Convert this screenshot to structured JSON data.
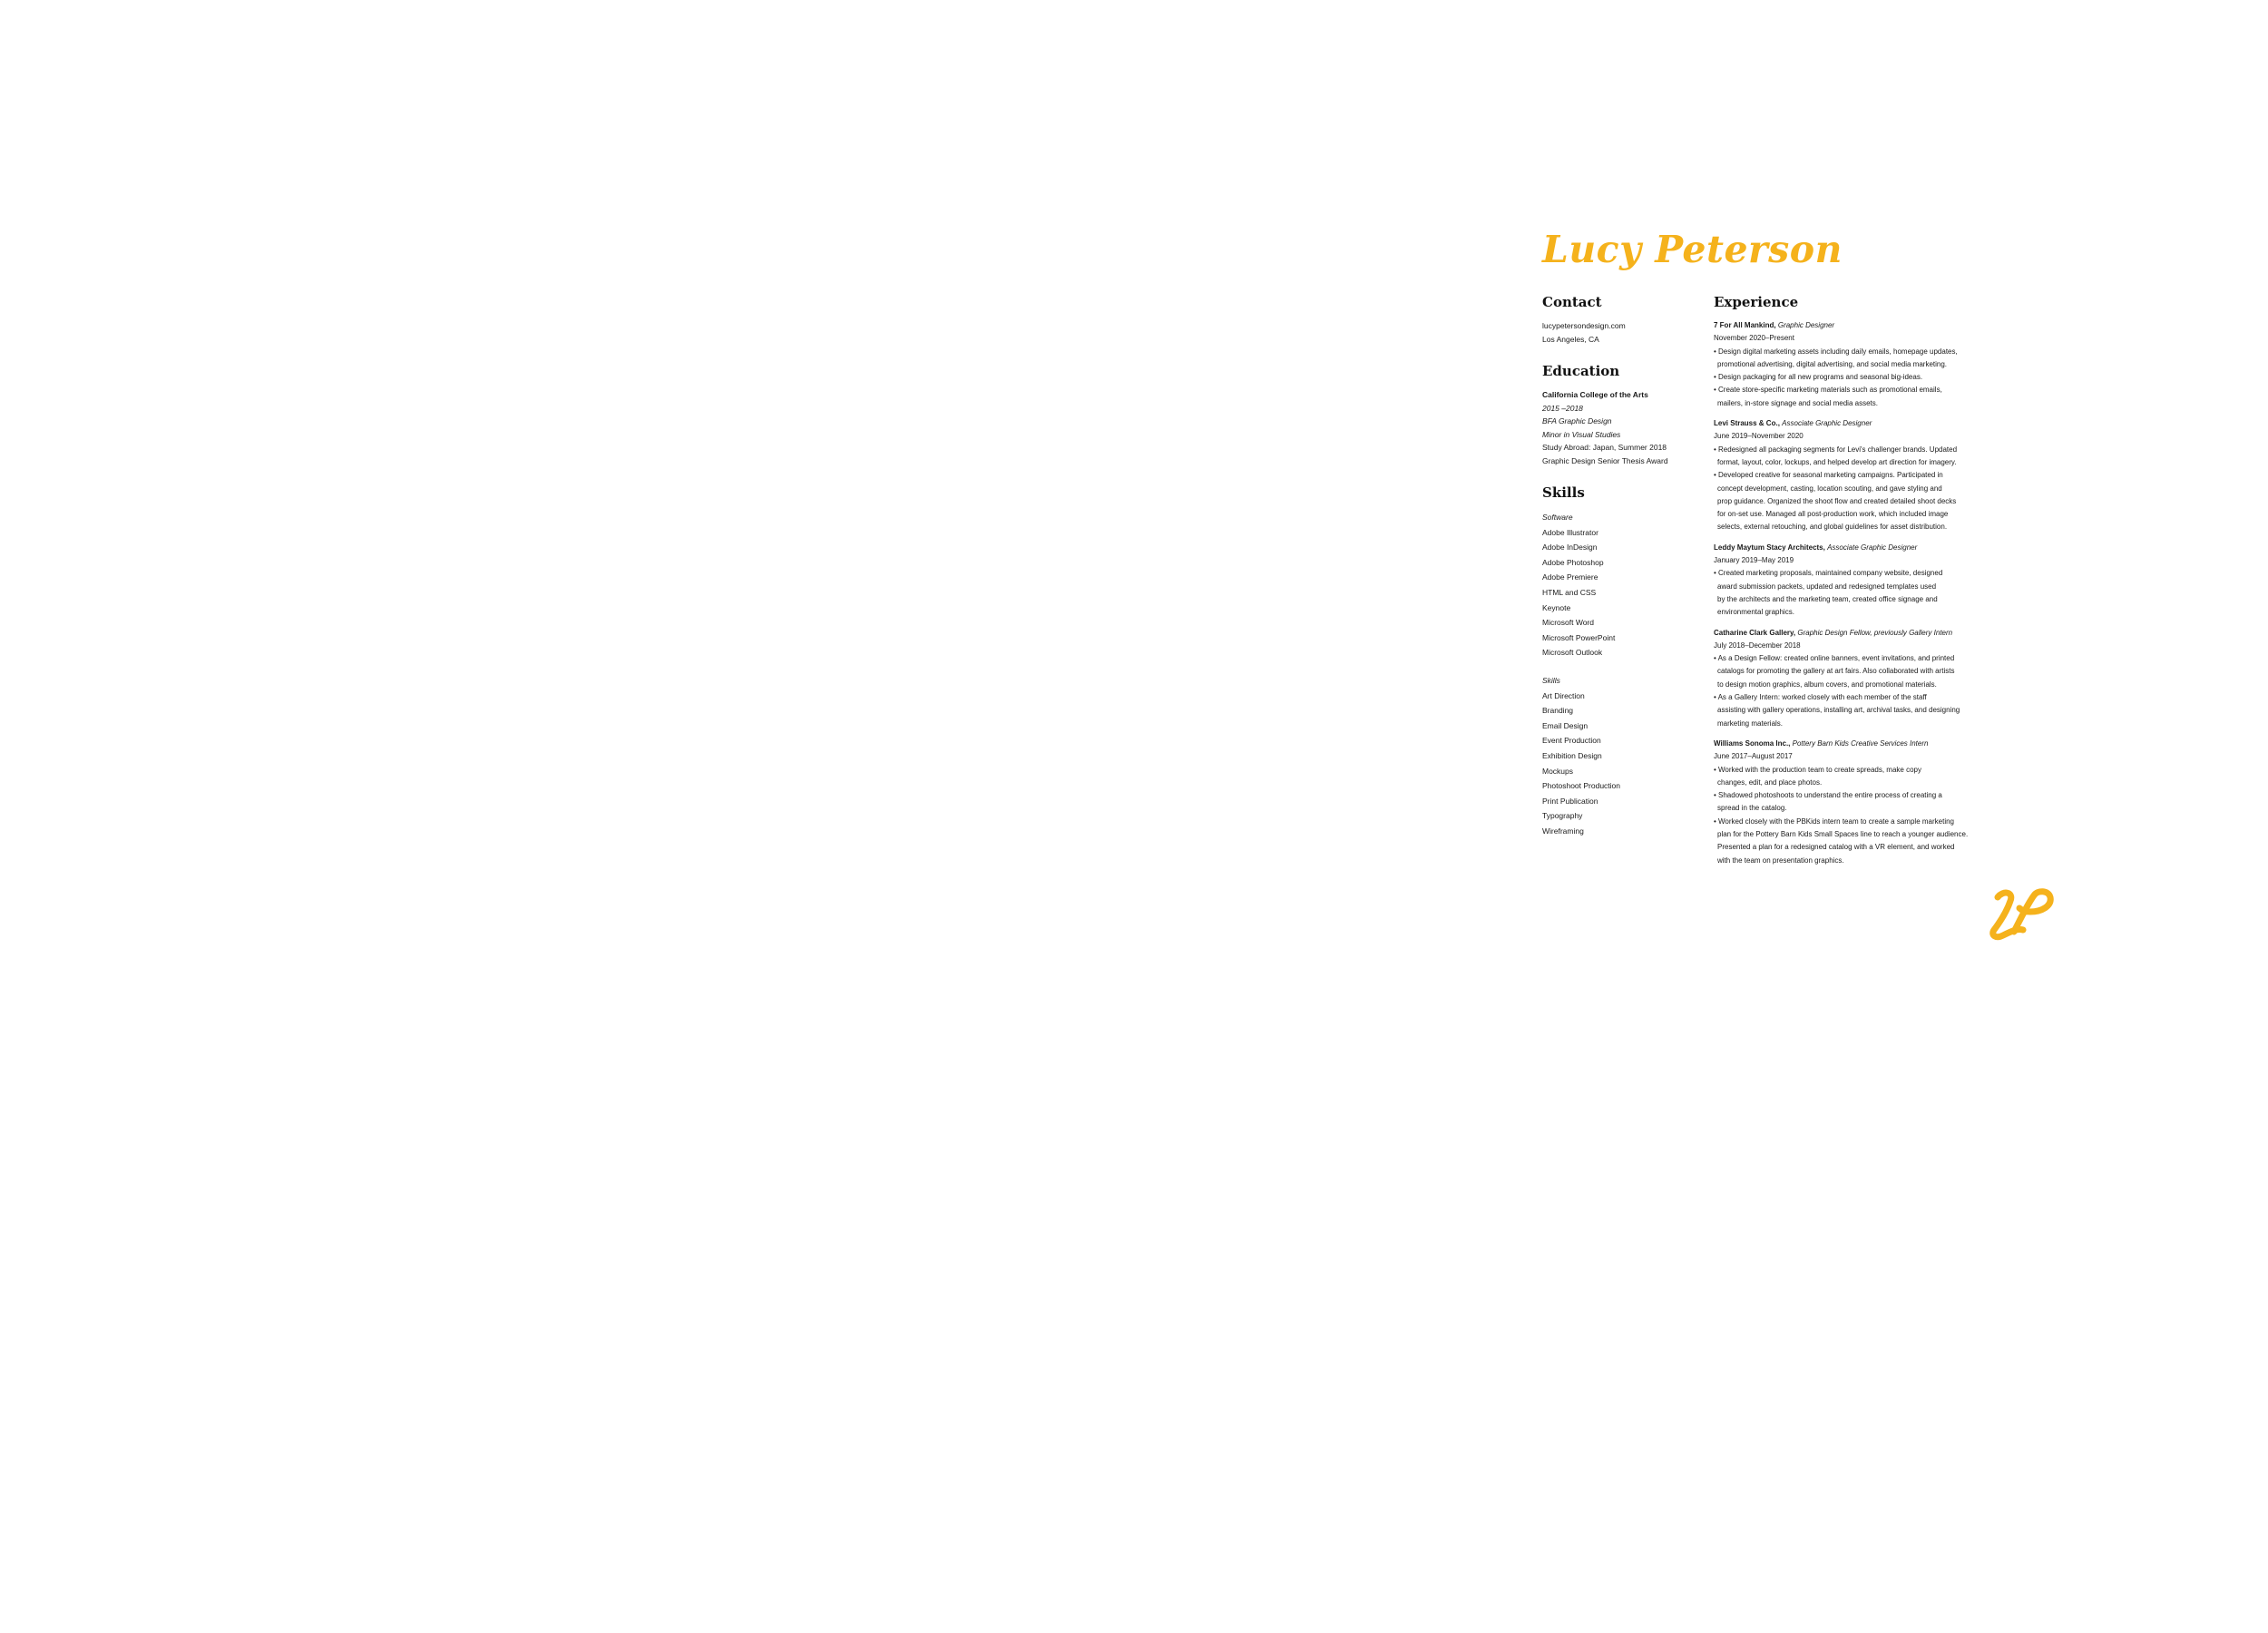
{
  "name": "Lucy Peterson",
  "accent_color": "#f5b21c",
  "contact": {
    "heading": "Contact",
    "website": "lucypetersondesign.com",
    "location": "Los Angeles, CA"
  },
  "education": {
    "heading": "Education",
    "school": "California College of the Arts",
    "years": "2015 –2018",
    "degree": "BFA Graphic Design",
    "minor": "Minor in Visual Studies",
    "abroad": "Study Abroad: Japan, Summer 2018",
    "award": "Graphic Design Senior Thesis Award"
  },
  "skills": {
    "heading": "Skills",
    "software_label": "Software",
    "software": [
      "Adobe Illustrator",
      "Adobe InDesign",
      "Adobe Photoshop",
      "Adobe Premiere",
      "HTML and CSS",
      "Keynote",
      "Microsoft Word",
      "Microsoft PowerPoint",
      "Microsoft Outlook"
    ],
    "skills_label": "Skills",
    "skills": [
      "Art Direction",
      "Branding",
      "Email Design",
      "Event Production",
      "Exhibition Design",
      "Mockups",
      "Photoshoot Production",
      "Print Publication",
      "Typography",
      "Wireframing"
    ]
  },
  "experience": {
    "heading": "Experience",
    "jobs": [
      {
        "company": "7 For All Mankind,",
        "role": "Graphic Designer",
        "dates": "November 2020–Present",
        "lines": [
          "• Design digital marketing assets including daily emails, homepage updates,",
          "promotional advertising, digital advertising, and social media marketing.",
          "• Design packaging for all new programs and seasonal big-ideas.",
          "• Create store-specific marketing materials such as promotional emails,",
          "mailers, in-store signage and social media assets."
        ]
      },
      {
        "company": "Levi Strauss & Co.,",
        "role": "Associate Graphic Designer",
        "dates": "June 2019–November 2020",
        "lines": [
          "• Redesigned all packaging segments for Levi's challenger brands. Updated",
          "format, layout, color, lockups, and helped develop art direction for imagery.",
          "• Developed creative for seasonal marketing campaigns. Participated in",
          "concept development, casting, location scouting, and gave styling and",
          "prop guidance. Organized the shoot flow and created detailed shoot decks",
          "for on-set use. Managed all post-production work, which included image",
          "selects, external retouching, and global guidelines for asset distribution."
        ]
      },
      {
        "company": "Leddy Maytum Stacy Architects,",
        "role": "Associate Graphic Designer",
        "dates": "January 2019–May 2019",
        "lines": [
          "• Created marketing proposals, maintained company website, designed",
          "award submission packets, updated and redesigned templates used",
          "by the architects and the marketing team, created office signage and",
          "environmental graphics."
        ]
      },
      {
        "company": "Catharine Clark Gallery,",
        "role": "Graphic Design Fellow, previously Gallery Intern",
        "dates": "July 2018–December 2018",
        "lines": [
          "• As a Design Fellow: created online banners, event invitations, and printed",
          "catalogs for promoting the gallery at art fairs. Also collaborated with artists",
          "to design motion graphics, album covers, and promotional materials.",
          "• As a Gallery Intern: worked closely with each member of the staff",
          "assisting with gallery operations, installing art, archival tasks, and designing",
          "marketing materials."
        ]
      },
      {
        "company": "Williams Sonoma Inc.,",
        "role": "Pottery Barn Kids Creative Services Intern",
        "dates": "June 2017–August 2017",
        "lines": [
          "• Worked with the production team to create spreads, make copy",
          "changes, edit, and place photos.",
          "• Shadowed photoshoots to understand the entire process of creating a",
          "spread in the catalog.",
          "• Worked closely with the PBKids intern team to create a sample marketing",
          "plan for the Pottery Barn Kids Small Spaces line to reach a younger audience.",
          "Presented a plan for a redesigned catalog with a VR element, and worked",
          "with the team on presentation graphics."
        ]
      }
    ]
  },
  "monogram": "LP"
}
